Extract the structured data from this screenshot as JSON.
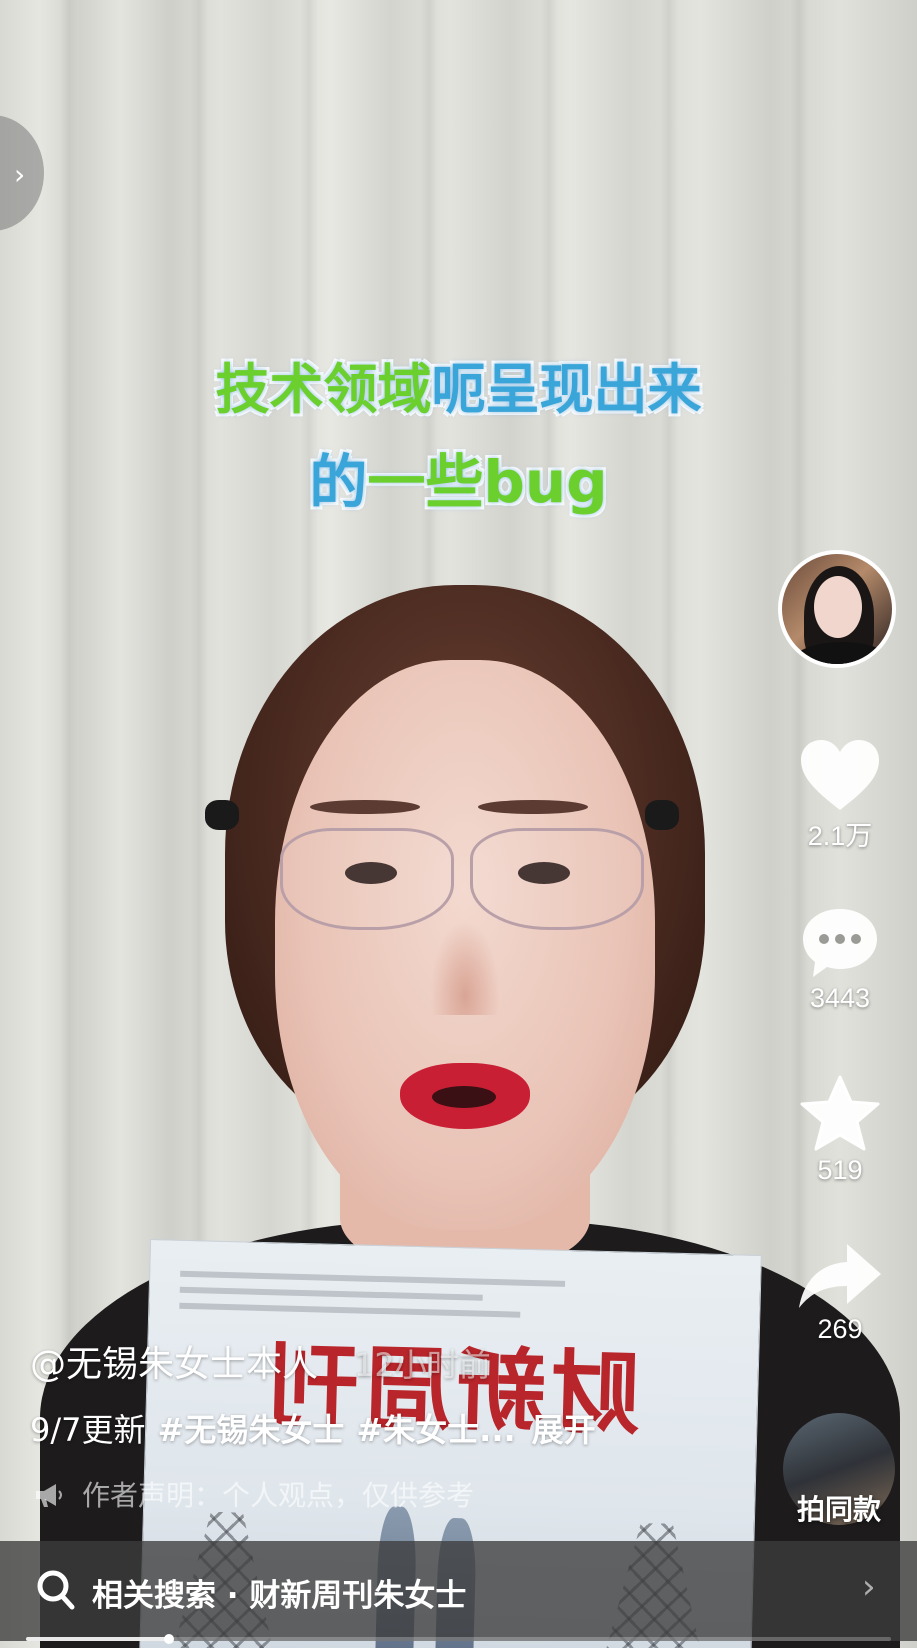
{
  "video": {
    "caption_line1_green": "技术领域",
    "caption_line1_blue": "呃呈现出来",
    "caption_line2_blue": "的",
    "caption_line2_green": "一些bug"
  },
  "sidebar": {
    "like_count": "2.1万",
    "comment_count": "3443",
    "favorite_count": "519",
    "share_count": "269",
    "template_label": "拍同款"
  },
  "post": {
    "author": "@无锡朱女士本人",
    "time": "12小时前",
    "desc_prefix": "9/7更新",
    "hashtag1": "#无锡朱女士",
    "hashtag2": "#朱女士...",
    "expand_label": "展开",
    "disclaimer": "作者声明：个人观点，仅供参考"
  },
  "related": {
    "text": "相关搜索 · 财新周刊朱女士"
  },
  "progress": {
    "fraction": 0.165
  },
  "colors": {
    "caption_green": "#6bcf2e",
    "caption_blue": "#3aa5d8"
  },
  "icons": {
    "left_tab": "chevron-right-icon",
    "like": "heart-icon",
    "comment": "chat-bubble-icon",
    "favorite": "star-icon",
    "share": "share-arrow-icon",
    "search": "search-icon",
    "disclaimer": "megaphone-icon"
  }
}
